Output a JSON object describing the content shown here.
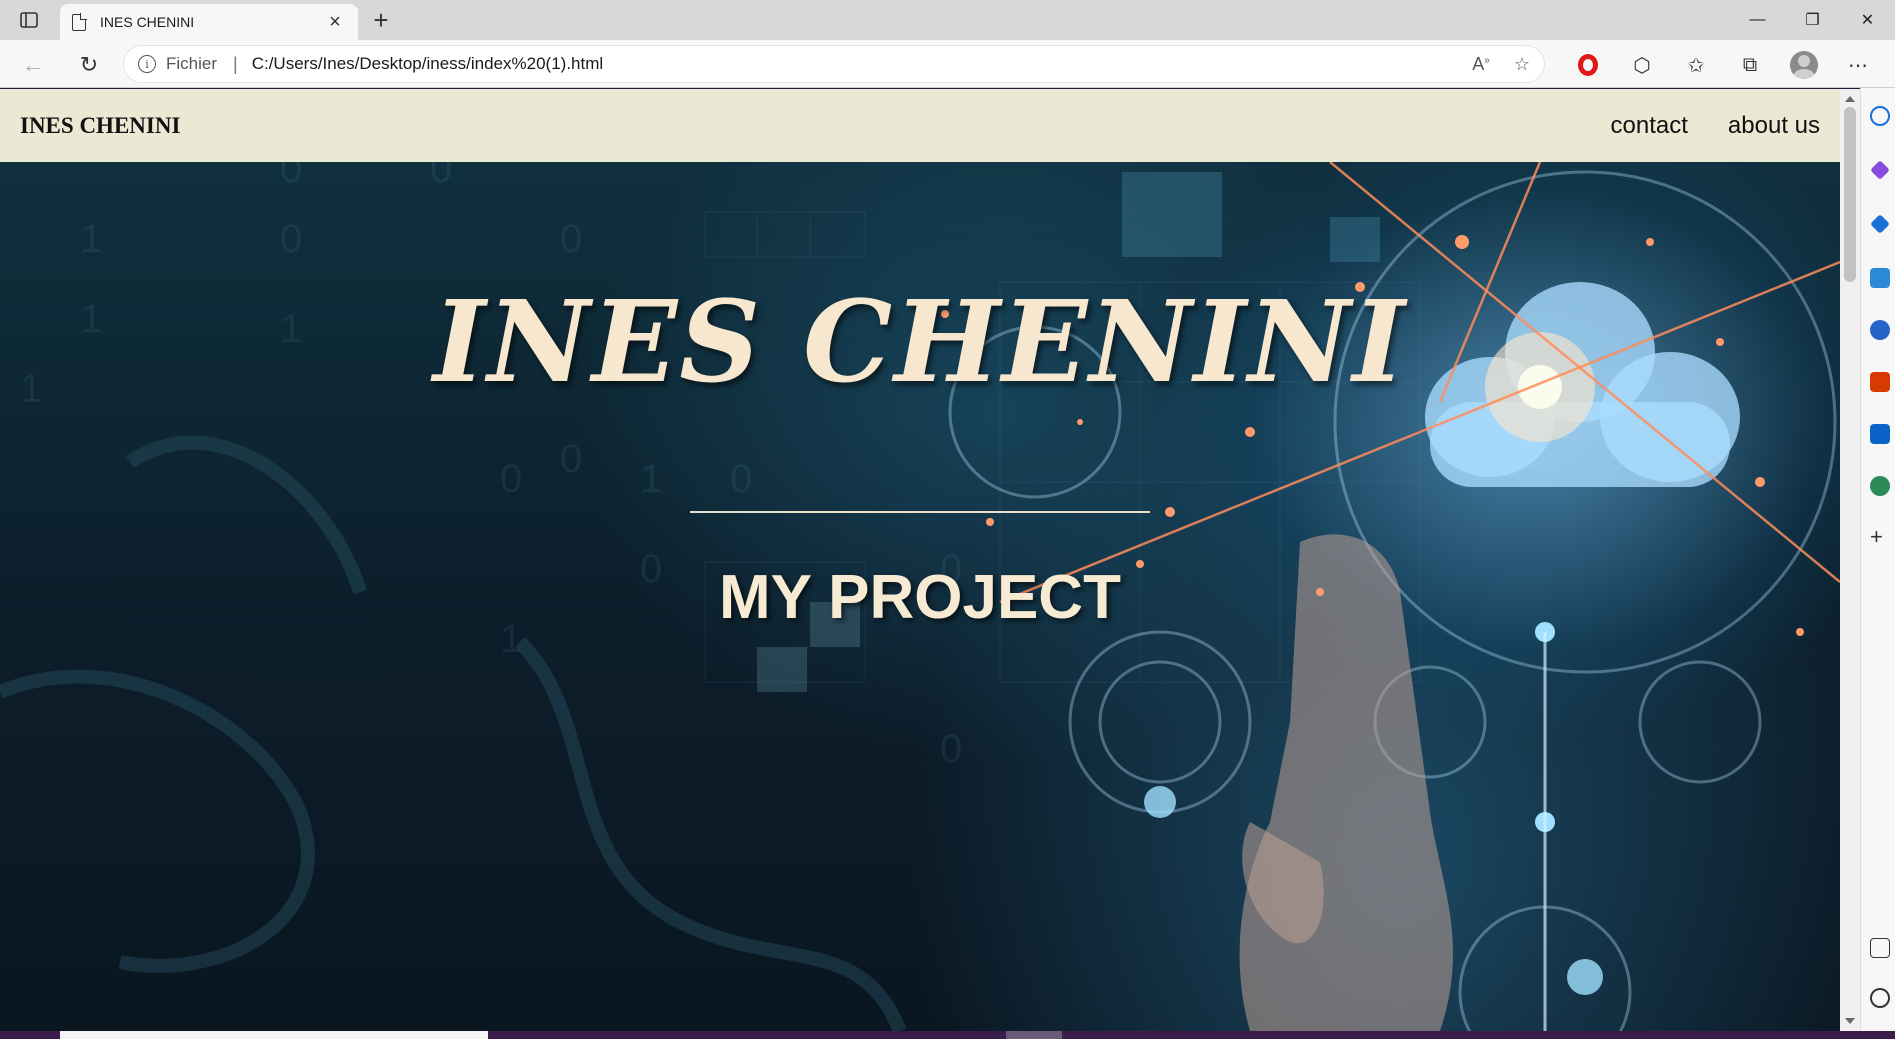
{
  "browser": {
    "tab_title": "INES CHENINI",
    "address_label": "Fichier",
    "address_url": "C:/Users/Ines/Desktop/iness/index%20(1).html"
  },
  "site": {
    "brand": "INES CHENINI",
    "nav": [
      {
        "label": "contact"
      },
      {
        "label": "about us"
      }
    ],
    "hero": {
      "title": "INES CHENINI",
      "subtitle": "MY PROJECT"
    }
  },
  "colors": {
    "nav_background": "#ebe8d3",
    "hero_text": "#f7e7cf",
    "hero_background": "#0f2130"
  }
}
